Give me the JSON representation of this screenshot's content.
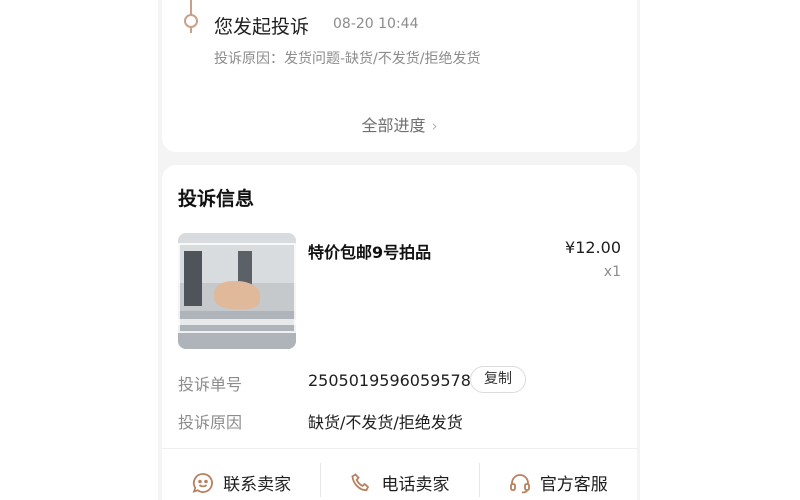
{
  "timeline": {
    "title": "您发起投诉",
    "time": "08-20 10:44",
    "reason": "投诉原因：发货问题-缺货/不发货/拒绝发货",
    "all_progress": "全部进度",
    "accent_color": "#c9a08a"
  },
  "info": {
    "title": "投诉信息",
    "product": {
      "name": "特价包邮9号拍品",
      "price": "¥12.00",
      "qty": "x1"
    },
    "rows": [
      {
        "label": "投诉单号",
        "value": "2505019596059578"
      },
      {
        "label": "投诉原因",
        "value": "缺货/不发货/拒绝发货"
      }
    ],
    "copy_label": "复制"
  },
  "bottom_bar": [
    {
      "label": "联系卖家",
      "icon": "chat-smile-icon"
    },
    {
      "label": "电话卖家",
      "icon": "phone-icon"
    },
    {
      "label": "官方客服",
      "icon": "headset-icon"
    }
  ]
}
